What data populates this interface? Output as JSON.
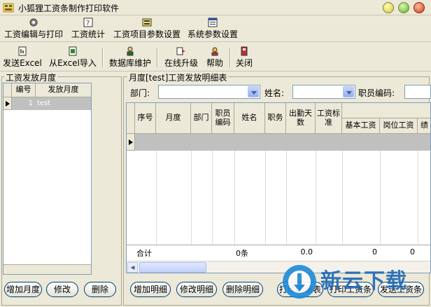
{
  "window": {
    "title": "小狐狸工资条制作打印软件"
  },
  "menu": [
    {
      "label": "工资编辑与打印",
      "icon": "tools-icon"
    },
    {
      "label": "工资统计",
      "icon": "stats-icon"
    },
    {
      "label": "工资项目参数设置",
      "icon": "item-settings-icon"
    },
    {
      "label": "系统参数设置",
      "icon": "system-settings-icon"
    }
  ],
  "toolbar": {
    "send_excel": "发送Excel",
    "import_excel": "从Excel导入",
    "db_maintain": "数据库维护",
    "online_upgrade": "在线升级",
    "help": "帮助",
    "close": "关闭"
  },
  "left_panel": {
    "title": "工资发放月度",
    "columns": [
      "编号",
      "发放月度"
    ],
    "rows": [
      {
        "id": "1",
        "month": "test"
      }
    ],
    "buttons": {
      "add": "增加月度",
      "edit": "修改",
      "delete": "删除"
    }
  },
  "right_panel": {
    "title": "月度[test]工资发放明细表",
    "filters": {
      "dept_label": "部门:",
      "name_label": "姓名:",
      "code_label": "职员编码:"
    },
    "columns": [
      "序号",
      "月度",
      "部门",
      "职员编码",
      "姓名",
      "职务",
      "出勤天数",
      "工资标准",
      "基本工资",
      "岗位工资",
      "绩"
    ],
    "total_row": {
      "label": "合计",
      "count": "0条",
      "attendance": "0.0",
      "basic": "0",
      "post": "0"
    },
    "buttons": {
      "add_detail": "增加明细",
      "edit_detail": "修改明细",
      "delete_detail": "删除明细",
      "print_detail": "打印明细表",
      "print_slip": "打印工资条",
      "send_slip": "发送工资条"
    }
  },
  "watermark": {
    "brand": "新云下载"
  }
}
